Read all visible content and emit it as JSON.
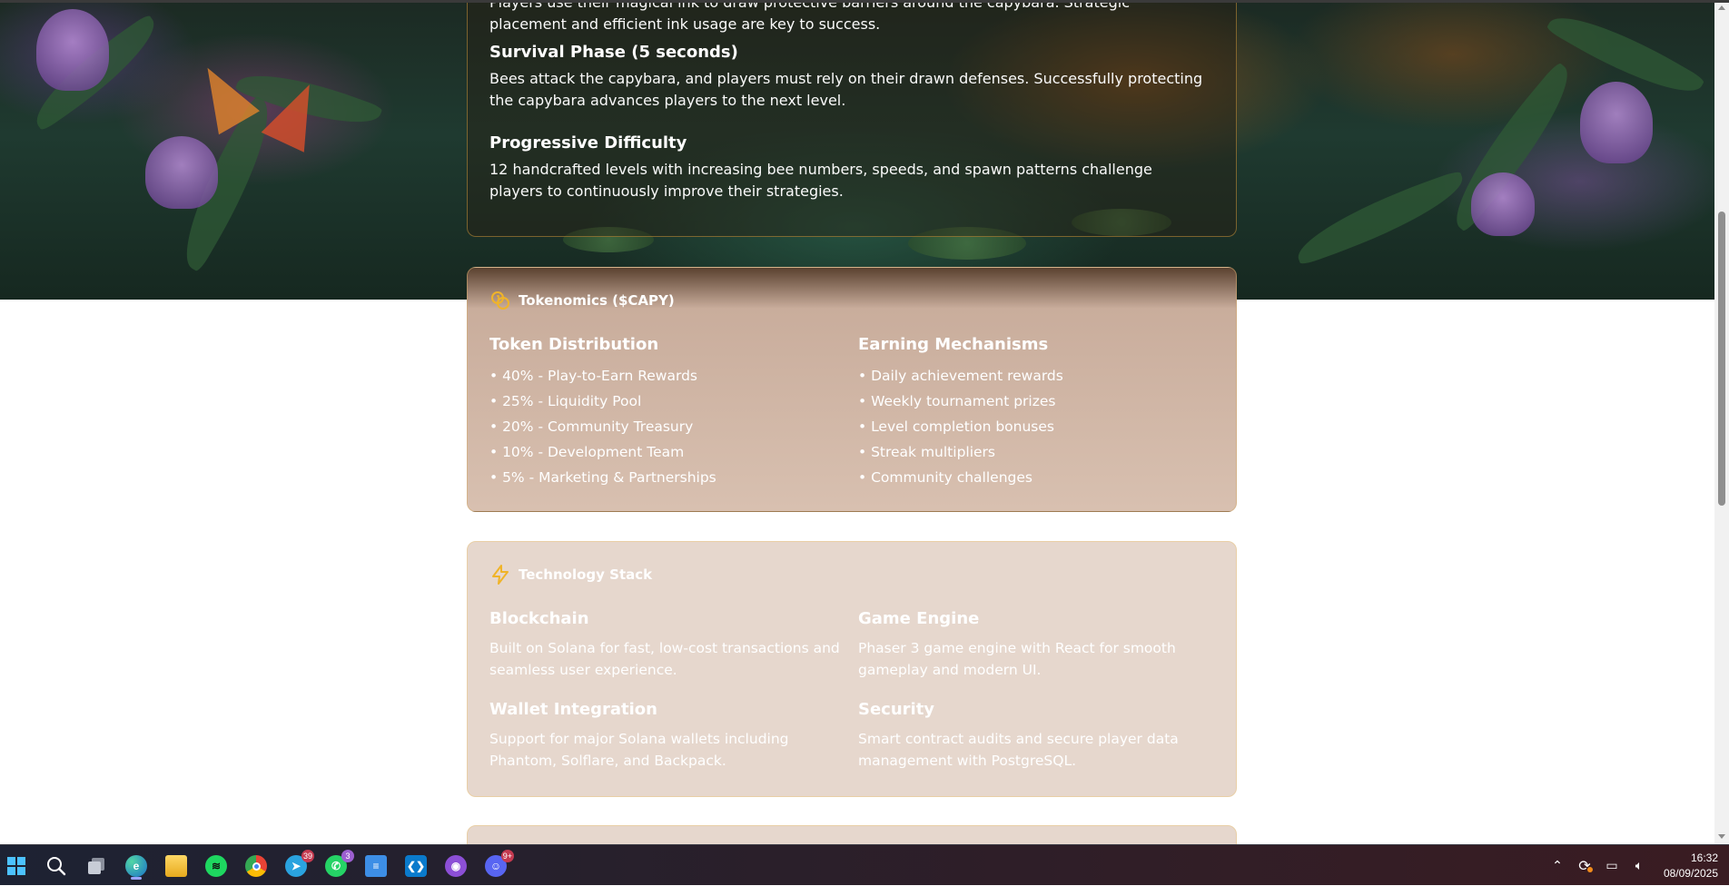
{
  "gameplay": {
    "partial_text": "Players use their magical ink to draw protective barriers around the capybara. Strategic placement and efficient ink usage are key to success.",
    "sections": [
      {
        "title": "Survival Phase (5 seconds)",
        "text": "Bees attack the capybara, and players must rely on their drawn defenses. Successfully protecting the capybara advances players to the next level."
      },
      {
        "title": "Progressive Difficulty",
        "text": "12 handcrafted levels with increasing bee numbers, speeds, and spawn patterns challenge players to continuously improve their strategies."
      }
    ]
  },
  "tokenomics": {
    "title": "Tokenomics ($CAPY)",
    "icon": "coins-icon",
    "distribution": {
      "heading": "Token Distribution",
      "items": [
        "• 40% - Play-to-Earn Rewards",
        "• 25% - Liquidity Pool",
        "• 20% - Community Treasury",
        "• 10% - Development Team",
        "• 5% - Marketing & Partnerships"
      ]
    },
    "earning": {
      "heading": "Earning Mechanisms",
      "items": [
        "• Daily achievement rewards",
        "• Weekly tournament prizes",
        "• Level completion bonuses",
        "• Streak multipliers",
        "• Community challenges"
      ]
    }
  },
  "tech": {
    "title": "Technology Stack",
    "icon": "lightning-icon",
    "blocks": [
      {
        "heading": "Blockchain",
        "text": "Built on Solana for fast, low-cost transactions and seamless user experience."
      },
      {
        "heading": "Game Engine",
        "text": "Phaser 3 game engine with React for smooth gameplay and modern UI."
      },
      {
        "heading": "Wallet Integration",
        "text": "Support for major Solana wallets including Phantom, Solflare, and Backpack."
      },
      {
        "heading": "Security",
        "text": "Smart contract audits and secure player data management with PostgreSQL."
      }
    ]
  },
  "taskbar": {
    "apps": [
      {
        "name": "start-icon"
      },
      {
        "name": "search-icon"
      },
      {
        "name": "task-view-icon"
      },
      {
        "name": "edge-icon",
        "active": true
      },
      {
        "name": "file-explorer-icon"
      },
      {
        "name": "spotify-icon"
      },
      {
        "name": "chrome-icon"
      },
      {
        "name": "telegram-icon",
        "badge": "39"
      },
      {
        "name": "whatsapp-icon",
        "badge": "3"
      },
      {
        "name": "notepad-icon"
      },
      {
        "name": "vscode-icon"
      },
      {
        "name": "github-desktop-icon"
      },
      {
        "name": "discord-icon",
        "badge": "9+"
      }
    ],
    "time": "16:32",
    "date": "08/09/2025"
  },
  "colors": {
    "card_border": "#e9cfa6",
    "tech_bg": "#e6d7cd",
    "tokenomics_bg": "#d8c0b0",
    "icon_accent": "#f0b429"
  }
}
